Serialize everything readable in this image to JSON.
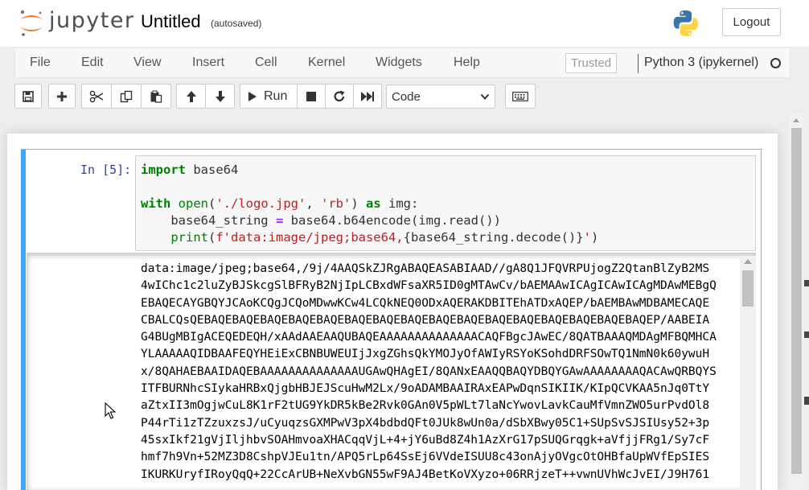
{
  "header": {
    "brand": "jupyter",
    "notebook_title": "Untitled",
    "save_status": "(autosaved)",
    "logout_label": "Logout",
    "logo_icon": "jupyter-logo-icon",
    "kernel_logo_icon": "python-logo-icon"
  },
  "menubar": {
    "items": [
      "File",
      "Edit",
      "View",
      "Insert",
      "Cell",
      "Kernel",
      "Widgets",
      "Help"
    ],
    "trusted_label": "Trusted",
    "kernel_name": "Python 3 (ipykernel)",
    "kernel_status_icon": "kernel-idle-icon"
  },
  "toolbar": {
    "buttons": [
      "save-icon",
      "add-cell-icon",
      "cut-icon",
      "copy-icon",
      "paste-icon",
      "move-up-icon",
      "move-down-icon",
      "run-icon",
      "stop-icon",
      "restart-icon",
      "fast-forward-icon",
      "keyboard-icon"
    ],
    "run_label": "Run",
    "cell_type": "Code"
  },
  "cell": {
    "prompt": "In [5]:",
    "code_lines": [
      "import base64",
      "",
      "with open('./logo.jpg', 'rb') as img:",
      "    base64_string = base64.b64encode(img.read())",
      "    print(f'data:image/jpeg;base64,{base64_string.decode()}')"
    ],
    "output_lines": [
      "data:image/jpeg;base64,/9j/4AAQSkZJRgABAQEASABIAAD//gA8Q1JFQVRPUjogZ2QtanBlZyB2MS",
      "4wIChc1c2luZyBJSkcgSlBFRyB2NjIpLCBxdWFsaXR5ID0gMTAwCv/bAEMAAwICAgICAwICAgMDAwMEBgQ",
      "EBAQECAYGBQYJCAoKCQgJCQoMDwwKCw4LCQkNEQ0ODxAQERAKDBITEhATDxAQEP/bAEMBAwMDBAMECAQE",
      "CBALCQsQEBAQEBAQEBAQEBAQEBAQEBAQEBAQEBAQEBAQEBAQEBAQEBAQEBAQEBAQEBAQEBAQEP/AABEIA",
      "G4BUgMBIgACEQEDEQH/xAAdAAEAAQUBAQEAAAAAAAAAAAAAACAQFBgcJAwEC/8QATBAAAQMDAgMFBQMHCA",
      "YLAAAAAQIDBAAFEQYHEiExCBNBUWEUIjJxgZGhsQkYMOJyOfAWIyRSYoKSohdDRFSOwTQ1NmN0k60ywuH",
      "x/8QAHAEBAAIDAQEBAAAAAAAAAAAAAAUGAwQHAgEI/8QANxEAAQQBAQYDBQYGAwAAAAAAAAQACAwQRBQYS",
      "ITFBURNhcSIykaHRBxQjgbHBJEJScuHwM2Lx/9oADAMBAAIRAxEAPwDqnSIKIIK/KIpQCVKAA5nJq0TtY",
      "aZtxII3mOgjwCuL8K1rF2tUG9YkDR5kBe2Rvk0GAn0V5pWLt7laNcYwovLavkCauMfVmnZWO5urPvdOl8",
      "P44rTi1zTZzuxzsJ/uCyuqzsGXMPwV3pX4bdbdQFt0JUk8wUn0a/dSbXBwy05C1+SUpSvSJSIUsy52+3p",
      "45sxIkf21gVjIljhbvSOAHmvoaXHACqqVjL+4+jY6uBd8Z4h1AzXrG17pSUQGrqgk+aVfjjFRg1/Sy7cF",
      "hmf7h9Vn+52MZ3D8CshpVJEu1tn/APQ5rLp64SsEj6VVdeISUU8c43onAjyOVgcOtOHBfaUpWVfEpSIES",
      "IKURKUryfIRoyQqQ+22CcArUB+NeXvbGN55wF9AJ4BetKoVXyzo+06RRjzeT++vwnUVhWcJvEI/J9H761"
    ]
  }
}
